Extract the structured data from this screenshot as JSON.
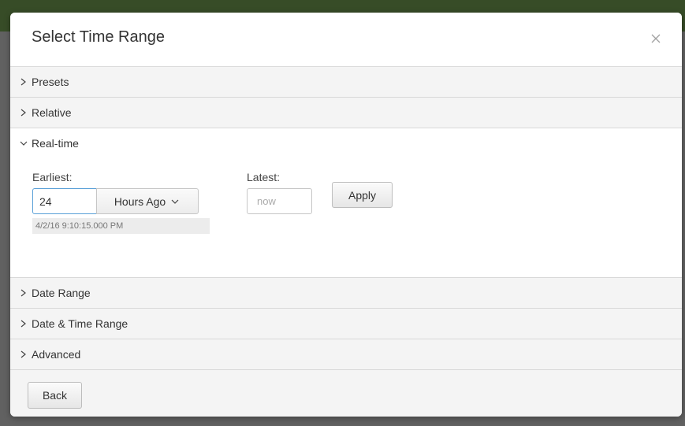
{
  "modal": {
    "title": "Select Time Range",
    "close_icon": "close-icon"
  },
  "sections": {
    "presets": {
      "label": "Presets",
      "expanded": false
    },
    "relative": {
      "label": "Relative",
      "expanded": false
    },
    "realtime": {
      "label": "Real-time",
      "expanded": true
    },
    "date_range": {
      "label": "Date Range",
      "expanded": false
    },
    "date_time_range": {
      "label": "Date & Time Range",
      "expanded": false
    },
    "advanced": {
      "label": "Advanced",
      "expanded": false
    }
  },
  "realtime": {
    "earliest_label": "Earliest:",
    "earliest_value": "24",
    "unit_selected": "Hours Ago",
    "earliest_timestamp": "4/2/16 9:10:15.000 PM",
    "latest_label": "Latest:",
    "latest_placeholder": "now",
    "apply_label": "Apply"
  },
  "footer": {
    "back_label": "Back"
  },
  "colors": {
    "input_focus_border": "#5aa0d8",
    "backdrop_accent": "#4a6b32"
  }
}
